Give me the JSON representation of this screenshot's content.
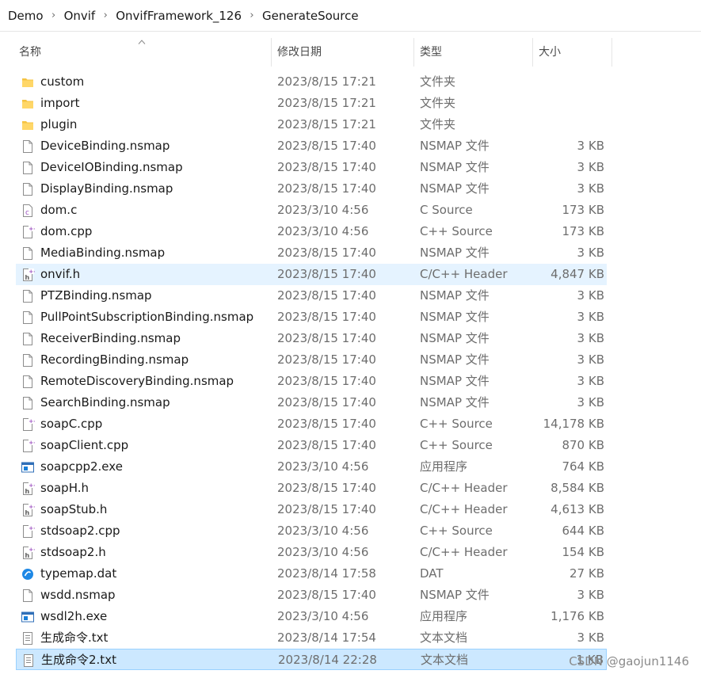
{
  "breadcrumb": [
    "Demo",
    "Onvif",
    "OnvifFramework_126",
    "GenerateSource"
  ],
  "columns": {
    "name": "名称",
    "date": "修改日期",
    "type": "类型",
    "size": "大小"
  },
  "files": [
    {
      "name": "custom",
      "date": "2023/8/15 17:21",
      "type": "文件夹",
      "size": "",
      "icon": "folder"
    },
    {
      "name": "import",
      "date": "2023/8/15 17:21",
      "type": "文件夹",
      "size": "",
      "icon": "folder"
    },
    {
      "name": "plugin",
      "date": "2023/8/15 17:21",
      "type": "文件夹",
      "size": "",
      "icon": "folder"
    },
    {
      "name": "DeviceBinding.nsmap",
      "date": "2023/8/15 17:40",
      "type": "NSMAP 文件",
      "size": "3 KB",
      "icon": "file"
    },
    {
      "name": "DeviceIOBinding.nsmap",
      "date": "2023/8/15 17:40",
      "type": "NSMAP 文件",
      "size": "3 KB",
      "icon": "file"
    },
    {
      "name": "DisplayBinding.nsmap",
      "date": "2023/8/15 17:40",
      "type": "NSMAP 文件",
      "size": "3 KB",
      "icon": "file"
    },
    {
      "name": "dom.c",
      "date": "2023/3/10 4:56",
      "type": "C Source",
      "size": "173 KB",
      "icon": "c-source"
    },
    {
      "name": "dom.cpp",
      "date": "2023/3/10 4:56",
      "type": "C++ Source",
      "size": "173 KB",
      "icon": "cpp-source"
    },
    {
      "name": "MediaBinding.nsmap",
      "date": "2023/8/15 17:40",
      "type": "NSMAP 文件",
      "size": "3 KB",
      "icon": "file"
    },
    {
      "name": "onvif.h",
      "date": "2023/8/15 17:40",
      "type": "C/C++ Header",
      "size": "4,847 KB",
      "icon": "header"
    },
    {
      "name": "PTZBinding.nsmap",
      "date": "2023/8/15 17:40",
      "type": "NSMAP 文件",
      "size": "3 KB",
      "icon": "file"
    },
    {
      "name": "PullPointSubscriptionBinding.nsmap",
      "date": "2023/8/15 17:40",
      "type": "NSMAP 文件",
      "size": "3 KB",
      "icon": "file"
    },
    {
      "name": "ReceiverBinding.nsmap",
      "date": "2023/8/15 17:40",
      "type": "NSMAP 文件",
      "size": "3 KB",
      "icon": "file"
    },
    {
      "name": "RecordingBinding.nsmap",
      "date": "2023/8/15 17:40",
      "type": "NSMAP 文件",
      "size": "3 KB",
      "icon": "file"
    },
    {
      "name": "RemoteDiscoveryBinding.nsmap",
      "date": "2023/8/15 17:40",
      "type": "NSMAP 文件",
      "size": "3 KB",
      "icon": "file"
    },
    {
      "name": "SearchBinding.nsmap",
      "date": "2023/8/15 17:40",
      "type": "NSMAP 文件",
      "size": "3 KB",
      "icon": "file"
    },
    {
      "name": "soapC.cpp",
      "date": "2023/8/15 17:40",
      "type": "C++ Source",
      "size": "14,178 KB",
      "icon": "cpp-source"
    },
    {
      "name": "soapClient.cpp",
      "date": "2023/8/15 17:40",
      "type": "C++ Source",
      "size": "870 KB",
      "icon": "cpp-source"
    },
    {
      "name": "soapcpp2.exe",
      "date": "2023/3/10 4:56",
      "type": "应用程序",
      "size": "764 KB",
      "icon": "exe"
    },
    {
      "name": "soapH.h",
      "date": "2023/8/15 17:40",
      "type": "C/C++ Header",
      "size": "8,584 KB",
      "icon": "header"
    },
    {
      "name": "soapStub.h",
      "date": "2023/8/15 17:40",
      "type": "C/C++ Header",
      "size": "4,613 KB",
      "icon": "header"
    },
    {
      "name": "stdsoap2.cpp",
      "date": "2023/3/10 4:56",
      "type": "C++ Source",
      "size": "644 KB",
      "icon": "cpp-source"
    },
    {
      "name": "stdsoap2.h",
      "date": "2023/3/10 4:56",
      "type": "C/C++ Header",
      "size": "154 KB",
      "icon": "header"
    },
    {
      "name": "typemap.dat",
      "date": "2023/8/14 17:58",
      "type": "DAT",
      "size": "27 KB",
      "icon": "dat"
    },
    {
      "name": "wsdd.nsmap",
      "date": "2023/8/15 17:40",
      "type": "NSMAP 文件",
      "size": "3 KB",
      "icon": "file"
    },
    {
      "name": "wsdl2h.exe",
      "date": "2023/3/10 4:56",
      "type": "应用程序",
      "size": "1,176 KB",
      "icon": "exe"
    },
    {
      "name": "生成命令.txt",
      "date": "2023/8/14 17:54",
      "type": "文本文档",
      "size": "3 KB",
      "icon": "text"
    },
    {
      "name": "生成命令2.txt",
      "date": "2023/8/14 22:28",
      "type": "文本文档",
      "size": "1 KB",
      "icon": "text"
    }
  ],
  "hovered_row": "onvif.h",
  "selected_row": "生成命令2.txt",
  "watermark": "CSDN @gaojun1146",
  "colors": {
    "hover": "#e5f3ff",
    "selected": "#cce8ff",
    "folder": "#f5c342",
    "accent": "#9b4fbf"
  }
}
